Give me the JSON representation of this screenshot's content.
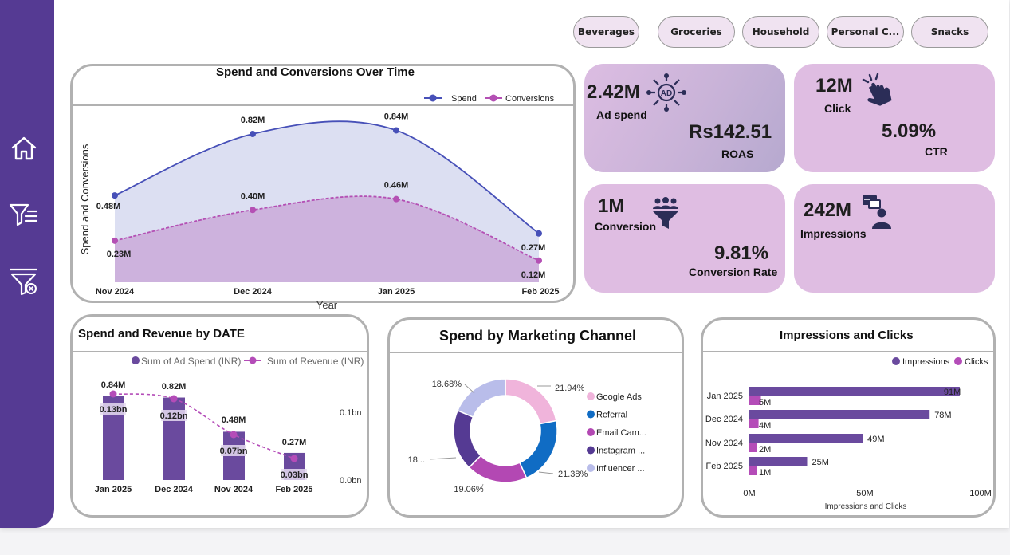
{
  "slicers": [
    "Beverages",
    "Groceries",
    "Household",
    "Personal C...",
    "Snacks"
  ],
  "sidebar": {
    "icons": [
      "home-icon",
      "filter-icon",
      "clear-filter-icon"
    ]
  },
  "kpis": {
    "ad_spend": {
      "value": "2.42M",
      "label": "Ad spend"
    },
    "roas": {
      "value": "Rs142.51",
      "label": "ROAS"
    },
    "click": {
      "value": "12M",
      "label": "Click"
    },
    "ctr": {
      "value": "5.09%",
      "label": "CTR"
    },
    "conversion": {
      "value": "1M",
      "label": "Conversion"
    },
    "conversion_rate": {
      "value": "9.81%",
      "label": "Conversion Rate"
    },
    "impressions": {
      "value": "242M",
      "label": "Impressions"
    }
  },
  "colors": {
    "sidebar": "#553a93",
    "spend": "#4750b8",
    "conversions": "#b450b4",
    "bar": "#6a4a9e",
    "revenue": "#b44cb8",
    "kpi_pink": "#dfbde2",
    "kpi_purple": "#c8aad6"
  },
  "charts": {
    "spend_conversions": {
      "title": "Spend and Conversions Over Time",
      "xlabel": "Year",
      "ylabel": "Spend and Conversions",
      "legend": [
        "Spend",
        "Conversions"
      ],
      "labels_spend": [
        "0.48M",
        "0.82M",
        "0.84M",
        "0.27M"
      ],
      "labels_conv": [
        "0.23M",
        "0.40M",
        "0.46M",
        "0.12M"
      ]
    },
    "spend_revenue": {
      "title": "Spend and Revenue by DATE",
      "legend": [
        "Sum of Ad Spend (INR)",
        "Sum of Revenue (INR)"
      ],
      "axis_ticks": [
        "0.1bn",
        "0.0bn"
      ],
      "labels_spend": [
        "0.84M",
        "0.82M",
        "0.48M",
        "0.27M"
      ],
      "labels_rev": [
        "0.13bn",
        "0.12bn",
        "0.07bn",
        "0.03bn"
      ]
    },
    "channel": {
      "title": "Spend by Marketing Channel",
      "labels": [
        "21.94%",
        "21.38%",
        "19.06%",
        "18...",
        "18.68%"
      ]
    },
    "imp_clicks": {
      "title": "Impressions and Clicks",
      "legend": [
        "Impressions",
        "Clicks"
      ],
      "xlabel": "Impressions and Clicks",
      "ticks": [
        "0M",
        "50M",
        "100M"
      ],
      "labels_imp": [
        "91M",
        "78M",
        "49M",
        "25M"
      ],
      "labels_clk": [
        "5M",
        "4M",
        "2M",
        "1M"
      ]
    }
  },
  "chart_data": [
    {
      "type": "area",
      "title": "Spend and Conversions Over Time",
      "x": [
        "Nov 2024",
        "Dec 2024",
        "Jan 2025",
        "Feb 2025"
      ],
      "xlabel": "Year",
      "ylabel": "Spend and Conversions",
      "legend": "top-right",
      "series": [
        {
          "name": "Spend",
          "values": [
            0.48,
            0.82,
            0.84,
            0.27
          ]
        },
        {
          "name": "Conversions",
          "values": [
            0.23,
            0.4,
            0.46,
            0.12
          ]
        }
      ],
      "units": "M"
    },
    {
      "type": "bar",
      "title": "Spend and Revenue by DATE",
      "categories": [
        "Jan 2025",
        "Dec 2024",
        "Nov 2024",
        "Feb 2025"
      ],
      "series": [
        {
          "name": "Sum of Ad Spend (INR)",
          "values": [
            0.84,
            0.82,
            0.48,
            0.27
          ],
          "units": "M"
        },
        {
          "name": "Sum of Revenue (INR)",
          "values": [
            0.13,
            0.12,
            0.07,
            0.03
          ],
          "units": "bn",
          "type": "line"
        }
      ],
      "secondary_ylim": [
        0.0,
        0.1
      ]
    },
    {
      "type": "pie",
      "title": "Spend by Marketing Channel",
      "categories": [
        "Google Ads",
        "Referral",
        "Email Cam...",
        "Instagram ...",
        "Influencer ..."
      ],
      "values": [
        21.94,
        21.38,
        19.06,
        18.94,
        18.68
      ],
      "units": "%"
    },
    {
      "type": "bar",
      "title": "Impressions and Clicks",
      "orientation": "horizontal",
      "categories": [
        "Jan 2025",
        "Dec 2024",
        "Nov 2024",
        "Feb 2025"
      ],
      "series": [
        {
          "name": "Impressions",
          "values": [
            91,
            78,
            49,
            25
          ]
        },
        {
          "name": "Clicks",
          "values": [
            5,
            4,
            2,
            1
          ]
        }
      ],
      "xlim": [
        0,
        100
      ],
      "xlabel": "Impressions and Clicks",
      "units": "M",
      "legend": "top-right"
    }
  ]
}
